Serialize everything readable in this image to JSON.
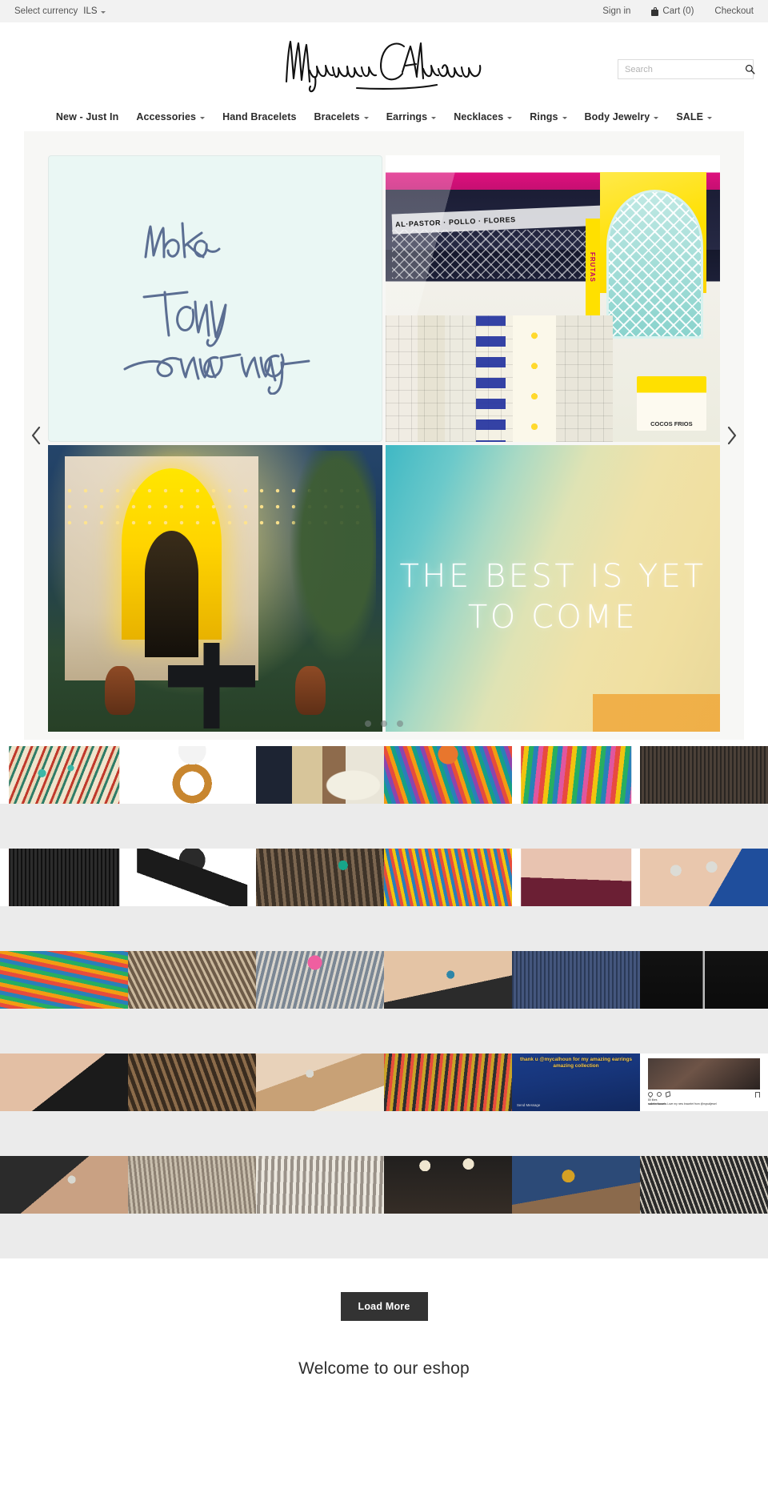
{
  "topbar": {
    "currency_label": "Select currency",
    "currency_value": "ILS",
    "sign_in": "Sign in",
    "cart": "Cart (0)",
    "checkout": "Checkout"
  },
  "header": {
    "logo_text": "Myriam Calhoun",
    "search_placeholder": "Search",
    "search_value": ""
  },
  "nav": {
    "items": [
      {
        "label": "New - Just In",
        "has_dropdown": false
      },
      {
        "label": "Accessories",
        "has_dropdown": true
      },
      {
        "label": "Hand Bracelets",
        "has_dropdown": false
      },
      {
        "label": "Bracelets",
        "has_dropdown": true
      },
      {
        "label": "Earrings",
        "has_dropdown": true
      },
      {
        "label": "Necklaces",
        "has_dropdown": true
      },
      {
        "label": "Rings",
        "has_dropdown": true
      },
      {
        "label": "Body Jewelry",
        "has_dropdown": true
      },
      {
        "label": "SALE",
        "has_dropdown": true
      }
    ]
  },
  "hero": {
    "prev_arrow": "‹",
    "next_arrow": "›",
    "note_text": "Make Today amazing",
    "taqueria_sign": "AL·PASTOR · POLLO · FLORES",
    "taqueria_frutas": "FRUTAS",
    "taqueria_cocos": "COCOS FRIOS",
    "best_text": "THE BEST IS YET TO COME",
    "dots": [
      {
        "active": false
      },
      {
        "active": false
      },
      {
        "active": false
      }
    ]
  },
  "instagram": {
    "rows": [
      {
        "cells": [
          {
            "name": "beaded-clutch-bag",
            "overlay": "",
            "sub": "",
            "type": "photo"
          },
          {
            "name": "crescent-horn-necklace",
            "overlay": "",
            "sub": "",
            "type": "photo"
          },
          {
            "name": "candle-and-perfume-display",
            "overlay": "",
            "sub": "",
            "type": "photo"
          },
          {
            "name": "colorful-feather-necklace",
            "overlay": "",
            "sub": "",
            "type": "photo"
          },
          {
            "name": "multicolor-pompom-clutch",
            "overlay": "",
            "sub": "",
            "type": "photo"
          },
          {
            "name": "fringe-tassel-earrings",
            "overlay": "",
            "sub": "",
            "type": "photo"
          }
        ]
      },
      {
        "cells": [
          {
            "name": "black-fringe-earrings",
            "overlay": "",
            "sub": "",
            "type": "photo"
          },
          {
            "name": "black-arrowhead-necklace",
            "overlay": "",
            "sub": "",
            "type": "photo"
          },
          {
            "name": "stacked-cuff-bracelets",
            "overlay": "",
            "sub": "",
            "type": "photo"
          },
          {
            "name": "boho-outfit-sandals",
            "overlay": "",
            "sub": "",
            "type": "photo"
          },
          {
            "name": "delicate-chain-necklace",
            "overlay": "",
            "sub": "",
            "type": "photo"
          },
          {
            "name": "silver-rings-on-hand",
            "overlay": "",
            "sub": "",
            "type": "photo"
          }
        ]
      },
      {
        "cells": [
          {
            "name": "colorful-bracelet-stack",
            "overlay": "",
            "sub": "",
            "type": "photo"
          },
          {
            "name": "layered-wrist-jewelry",
            "overlay": "",
            "sub": "",
            "type": "photo"
          },
          {
            "name": "pink-beaded-bracelets",
            "overlay": "",
            "sub": "",
            "type": "photo"
          },
          {
            "name": "turquoise-ring-closeup",
            "overlay": "",
            "sub": "",
            "type": "photo"
          },
          {
            "name": "fringe-detail-fabric",
            "overlay": "",
            "sub": "",
            "type": "photo"
          },
          {
            "name": "long-pendant-on-black",
            "overlay": "",
            "sub": "",
            "type": "photo"
          }
        ]
      },
      {
        "cells": [
          {
            "name": "choker-on-model",
            "overlay": "",
            "sub": "",
            "type": "photo"
          },
          {
            "name": "bracelets-on-table",
            "overlay": "",
            "sub": "",
            "type": "photo"
          },
          {
            "name": "silver-ear-cuff",
            "overlay": "",
            "sub": "",
            "type": "photo"
          },
          {
            "name": "beaded-cuff-on-wrist",
            "overlay": "",
            "sub": "",
            "type": "photo"
          },
          {
            "name": "customer-thank-you-story",
            "overlay": "thank u @mycalhoun for my amazing earrings amazing collection",
            "sub": "Send Message",
            "type": "story"
          },
          {
            "name": "instagram-post-screenshot",
            "overlay": "",
            "sub": "",
            "type": "igpost",
            "ig_likes": "80 likes",
            "ig_user": "sabrinelaoaris",
            "ig_caption": "Love my new bracelet from @mycaljewel"
          }
        ]
      },
      {
        "cells": [
          {
            "name": "ring-on-dark-sleeve",
            "overlay": "",
            "sub": "",
            "type": "photo"
          },
          {
            "name": "wrist-stack-on-laptop",
            "overlay": "",
            "sub": "",
            "type": "photo"
          },
          {
            "name": "cuff-bracelets-on-wood",
            "overlay": "",
            "sub": "",
            "type": "photo"
          },
          {
            "name": "starburst-earrings",
            "overlay": "",
            "sub": "",
            "type": "photo"
          },
          {
            "name": "gold-watch-and-denim",
            "overlay": "",
            "sub": "",
            "type": "photo"
          },
          {
            "name": "bracelet-on-black-top",
            "overlay": "",
            "sub": "",
            "type": "photo"
          }
        ]
      }
    ],
    "load_more": "Load More"
  },
  "welcome": {
    "title": "Welcome to our eshop"
  },
  "colors": {
    "topbar_bg": "#f2f2f2",
    "gap_bg": "#ebebeb",
    "button_bg": "#333333",
    "text": "#333333"
  }
}
